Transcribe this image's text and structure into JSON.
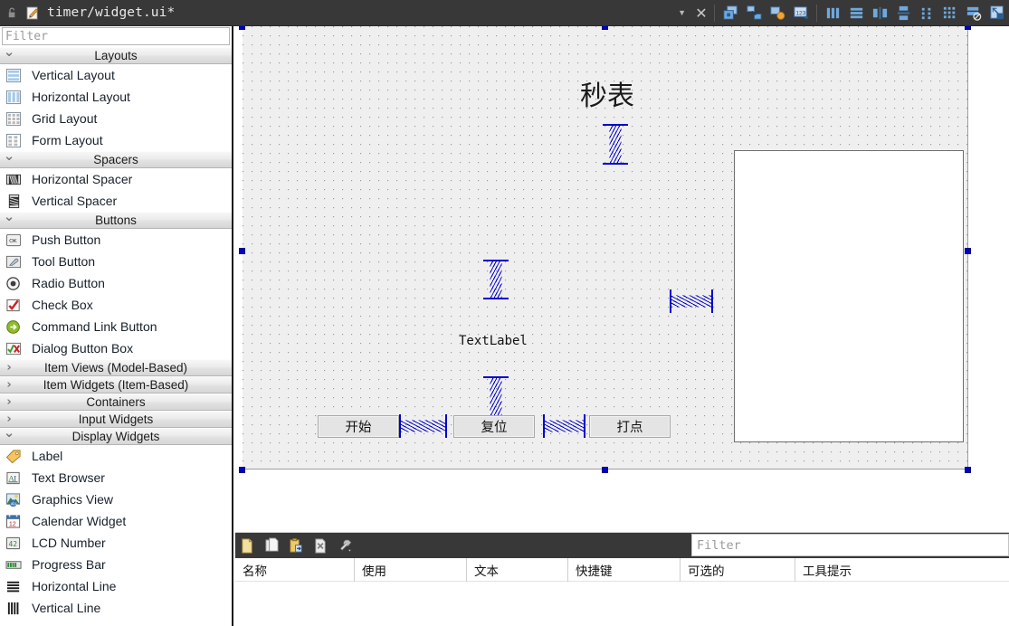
{
  "window": {
    "title": "timer/widget.ui*",
    "lock_icon": "unlock-icon",
    "doc_icon": "edit-document-icon",
    "dropdown_icon": "chevron-down-icon",
    "close_icon": "close-icon"
  },
  "toolbar": {
    "icons": [
      {
        "name": "edit-widgets-icon",
        "tip": "Edit Widgets"
      },
      {
        "name": "edit-signals-slots-icon",
        "tip": "Edit Signals/Slots"
      },
      {
        "name": "edit-buddies-icon",
        "tip": "Edit Buddies"
      },
      {
        "name": "edit-tab-order-icon",
        "tip": "Edit Tab Order"
      },
      {
        "name": "layout-horizontally-icon",
        "tip": "Lay Out Horizontally"
      },
      {
        "name": "layout-vertically-icon",
        "tip": "Lay Out Vertically"
      },
      {
        "name": "layout-splitter-horizontal-icon",
        "tip": "Lay Out Horizontally in Splitter"
      },
      {
        "name": "layout-splitter-vertical-icon",
        "tip": "Lay Out Vertically in Splitter"
      },
      {
        "name": "layout-form-icon",
        "tip": "Lay Out in a Form Layout"
      },
      {
        "name": "layout-grid-icon",
        "tip": "Lay Out in a Grid"
      },
      {
        "name": "break-layout-icon",
        "tip": "Break Layout"
      },
      {
        "name": "adjust-size-icon",
        "tip": "Adjust Size"
      }
    ]
  },
  "widgetbox": {
    "filter_placeholder": "Filter",
    "groups": [
      {
        "title": "Layouts",
        "expanded": true,
        "arrow": "chevron-down-icon",
        "items": [
          {
            "label": "Vertical Layout",
            "icon": "vertical-layout-icon"
          },
          {
            "label": "Horizontal Layout",
            "icon": "horizontal-layout-icon"
          },
          {
            "label": "Grid Layout",
            "icon": "grid-layout-icon"
          },
          {
            "label": "Form Layout",
            "icon": "form-layout-icon"
          }
        ]
      },
      {
        "title": "Spacers",
        "expanded": true,
        "arrow": "chevron-down-icon",
        "items": [
          {
            "label": "Horizontal Spacer",
            "icon": "horizontal-spacer-icon"
          },
          {
            "label": "Vertical Spacer",
            "icon": "vertical-spacer-icon"
          }
        ]
      },
      {
        "title": "Buttons",
        "expanded": true,
        "arrow": "chevron-down-icon",
        "items": [
          {
            "label": "Push Button",
            "icon": "push-button-icon"
          },
          {
            "label": "Tool Button",
            "icon": "tool-button-icon"
          },
          {
            "label": "Radio Button",
            "icon": "radio-button-icon"
          },
          {
            "label": "Check Box",
            "icon": "check-box-icon"
          },
          {
            "label": "Command Link Button",
            "icon": "command-link-button-icon"
          },
          {
            "label": "Dialog Button Box",
            "icon": "dialog-button-box-icon"
          }
        ]
      },
      {
        "title": "Item Views (Model-Based)",
        "expanded": false,
        "arrow": "chevron-right-icon",
        "items": []
      },
      {
        "title": "Item Widgets (Item-Based)",
        "expanded": false,
        "arrow": "chevron-right-icon",
        "items": []
      },
      {
        "title": "Containers",
        "expanded": false,
        "arrow": "chevron-right-icon",
        "items": []
      },
      {
        "title": "Input Widgets",
        "expanded": false,
        "arrow": "chevron-right-icon",
        "items": []
      },
      {
        "title": "Display Widgets",
        "expanded": true,
        "arrow": "chevron-down-icon",
        "items": [
          {
            "label": "Label",
            "icon": "label-icon"
          },
          {
            "label": "Text Browser",
            "icon": "text-browser-icon"
          },
          {
            "label": "Graphics View",
            "icon": "graphics-view-icon"
          },
          {
            "label": "Calendar Widget",
            "icon": "calendar-widget-icon"
          },
          {
            "label": "LCD Number",
            "icon": "lcd-number-icon"
          },
          {
            "label": "Progress Bar",
            "icon": "progress-bar-icon"
          },
          {
            "label": "Horizontal Line",
            "icon": "horizontal-line-icon"
          },
          {
            "label": "Vertical Line",
            "icon": "vertical-line-icon"
          }
        ]
      }
    ]
  },
  "form": {
    "selected": true,
    "title_label": "秒表",
    "text_label": "TextLabel",
    "buttons": [
      {
        "label": "开始"
      },
      {
        "label": "复位"
      },
      {
        "label": "打点"
      }
    ],
    "text_browser": {
      "name": "text-browser-widget"
    },
    "spacers": [
      {
        "kind": "vertical",
        "name": "vertical-spacer-top"
      },
      {
        "kind": "vertical",
        "name": "vertical-spacer-middle"
      },
      {
        "kind": "vertical",
        "name": "vertical-spacer-below-label"
      },
      {
        "kind": "horizontal",
        "name": "horizontal-spacer-right"
      },
      {
        "kind": "horizontal",
        "name": "horizontal-spacer-buttons-1"
      },
      {
        "kind": "horizontal",
        "name": "horizontal-spacer-buttons-2"
      }
    ]
  },
  "actioneditor": {
    "filter_placeholder": "Filter",
    "tools": [
      {
        "name": "new-action-icon"
      },
      {
        "name": "copy-action-icon"
      },
      {
        "name": "paste-action-icon"
      },
      {
        "name": "delete-action-icon"
      },
      {
        "name": "configure-icon"
      }
    ],
    "columns": [
      "名称",
      "使用",
      "文本",
      "快捷键",
      "可选的",
      "工具提示"
    ],
    "rows": []
  },
  "colors": {
    "dark_bar": "#383838",
    "selection_handle": "#0000c8",
    "spacer_blue": "#0000cd",
    "form_bg": "#efefef"
  }
}
